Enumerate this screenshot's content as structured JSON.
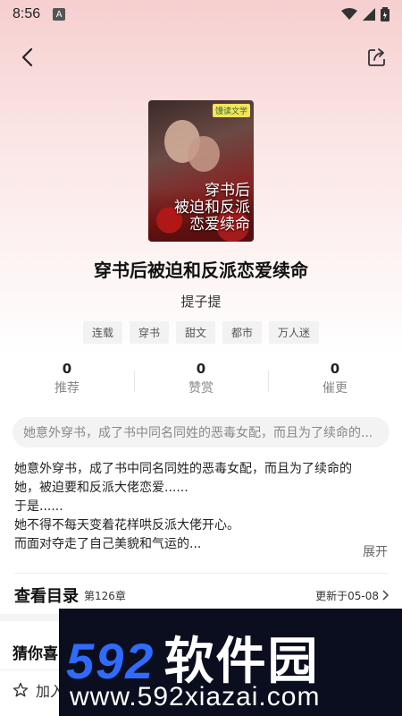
{
  "status_bar": {
    "time": "8:56",
    "notif_letter": "A"
  },
  "book": {
    "title": "穿书后被迫和反派恋爱续命",
    "author": "提子提",
    "cover_tag": "馒读文学",
    "cover_title_line1": "穿书后",
    "cover_title_line2": "被迫和反派",
    "cover_title_line3": "恋爱续命",
    "tags": [
      "连载",
      "穿书",
      "甜文",
      "都市",
      "万人迷"
    ]
  },
  "stats": [
    {
      "value": "0",
      "label": "推荐"
    },
    {
      "value": "0",
      "label": "赞赏"
    },
    {
      "value": "0",
      "label": "催更"
    }
  ],
  "summary_preview": "她意外穿书，成了书中同名同姓的恶毒女配，而且为了续命的...",
  "description": {
    "line1": "她意外穿书，成了书中同名同姓的恶毒女配，而且为了续命的",
    "line2": "她，被迫要和反派大佬恋爱......",
    "line3": "于是......",
    "line4": "她不得不每天变着花样哄反派大佬开心。",
    "line5": "而面对夺走了自己美貌和气运的...",
    "expand": "展开"
  },
  "catalog": {
    "title": "查看目录",
    "count": "第126章",
    "update": "更新于05-08"
  },
  "guess_title": "猜你喜",
  "bottom": {
    "add_shelf": "加入"
  },
  "watermark": {
    "brand_num": "592",
    "brand_cn": "软件园",
    "url": "www.592xiazai.com"
  },
  "colors": {
    "hero_top": "#f6cfcf",
    "watermark_bg": "#0b0e1f",
    "watermark_blue": "#2f6bff"
  }
}
